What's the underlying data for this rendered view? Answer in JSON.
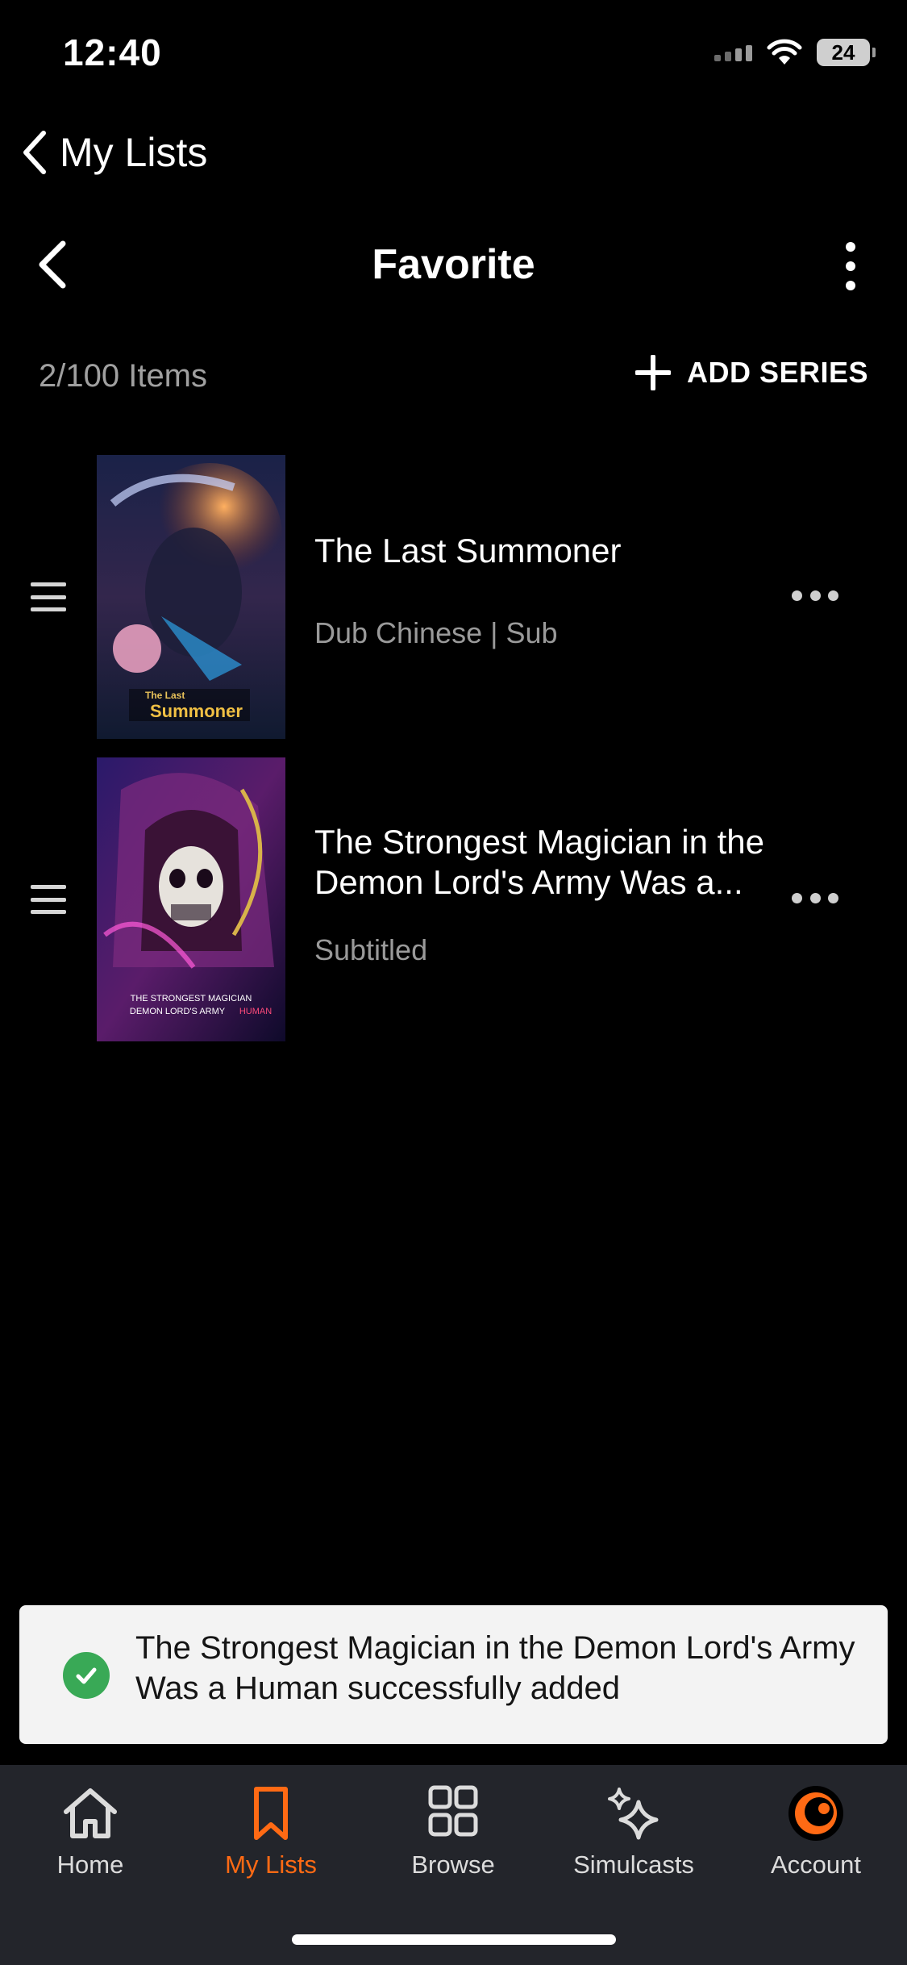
{
  "status_bar": {
    "time": "12:40",
    "battery": "24"
  },
  "nav": {
    "back_label": "My Lists",
    "title": "Favorite"
  },
  "list_header": {
    "count": "2/100 Items",
    "add_series_label": "ADD SERIES"
  },
  "items": [
    {
      "title": "The Last Summoner",
      "subtitle": "Dub Chinese | Sub",
      "poster_text": "Summoner",
      "poster_subtext": "The Last"
    },
    {
      "title": "The Strongest Magician in the Demon Lord's Army Was a...",
      "subtitle": "Subtitled",
      "poster_text": "THE STRONGEST MAGICIAN",
      "poster_subtext": "DEMON LORD'S ARMY",
      "poster_accent": "HUMAN"
    }
  ],
  "toast": {
    "message": "The Strongest Magician in the Demon Lord's Army Was a Human successfully added"
  },
  "tabs": [
    {
      "label": "Home",
      "icon": "home-icon"
    },
    {
      "label": "My Lists",
      "icon": "bookmark-icon",
      "active": true
    },
    {
      "label": "Browse",
      "icon": "grid-icon"
    },
    {
      "label": "Simulcasts",
      "icon": "sparkle-icon"
    },
    {
      "label": "Account",
      "icon": "crunchyroll-logo-icon"
    }
  ],
  "colors": {
    "accent": "#ff6a14",
    "success": "#39a956",
    "background": "#000000",
    "tabbar": "#23252b"
  }
}
